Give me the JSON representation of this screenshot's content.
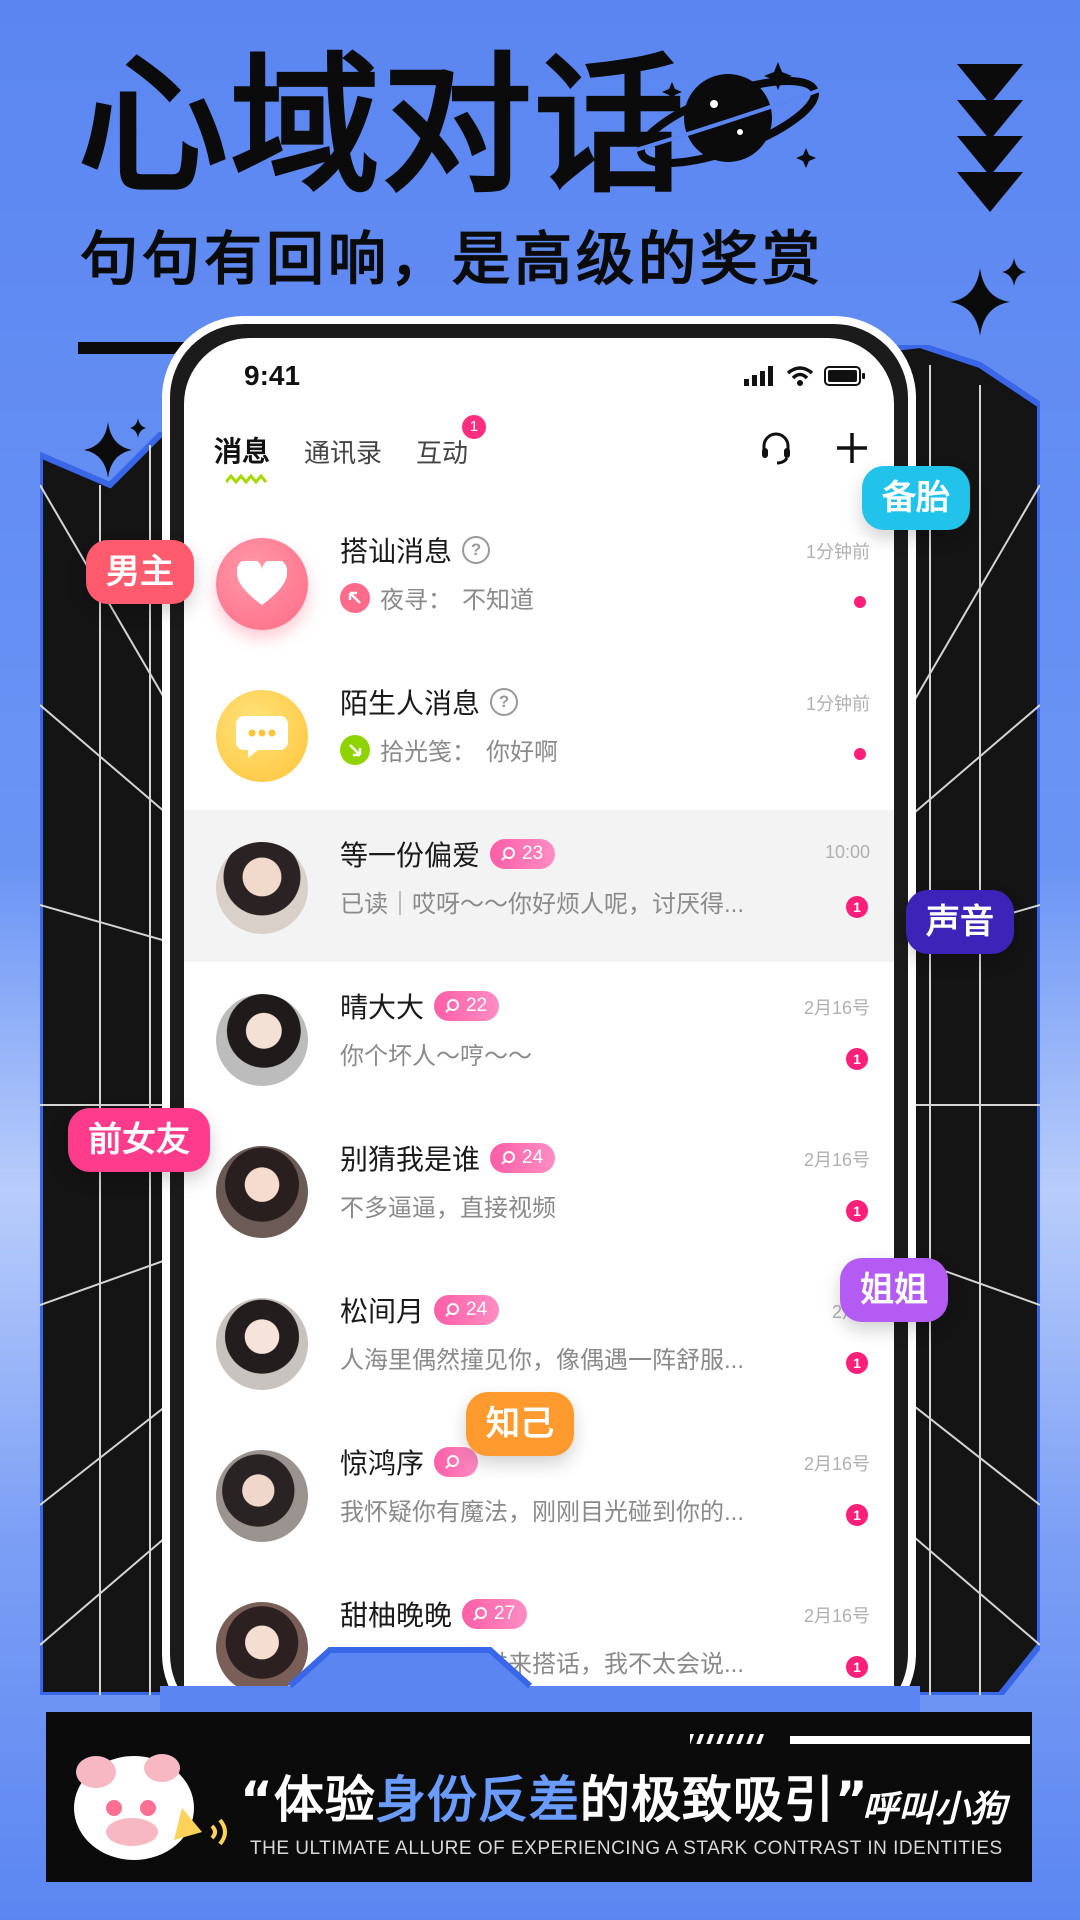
{
  "header": {
    "title": "心域对话",
    "subtitle": "句句有回响，是高级的奖赏"
  },
  "status_bar": {
    "time": "9:41"
  },
  "tabs": [
    {
      "label": "消息",
      "active": true
    },
    {
      "label": "通讯录",
      "active": false
    },
    {
      "label": "互动",
      "active": false,
      "badge": "1"
    }
  ],
  "top_icons": [
    "headset-icon",
    "plus-icon"
  ],
  "conversations": [
    {
      "name": "搭讪消息",
      "help": "?",
      "preview_from": "夜寻：",
      "preview": "不知道",
      "time": "1分钟前",
      "kind": "system",
      "unread_dot": true
    },
    {
      "name": "陌生人消息",
      "help": "?",
      "preview_from": "拾光笺：",
      "preview": "你好啊",
      "time": "1分钟前",
      "kind": "system",
      "unread_dot": true
    },
    {
      "name": "等一份偏爱",
      "level": "23",
      "preview": "已读｜哎呀～～你好烦人呢，讨厌得...",
      "time": "10:00",
      "unread": "1"
    },
    {
      "name": "晴大大",
      "level": "22",
      "preview": "你个坏人～哼～～",
      "time": "2月16号",
      "unread": "1"
    },
    {
      "name": "别猜我是谁",
      "level": "24",
      "preview": "不多逼逼，直接视频",
      "time": "2月16号",
      "unread": "1"
    },
    {
      "name": "松间月",
      "level": "24",
      "preview": "人海里偶然撞见你，像偶遇一阵舒服...",
      "time": "2月1",
      "unread": "1"
    },
    {
      "name": "惊鸿序",
      "level": "",
      "preview": "我怀疑你有魔法，刚刚目光碰到你的...",
      "time": "2月16号",
      "unread": "1"
    },
    {
      "name": "甜柚晚晚",
      "level": "27",
      "preview": "犹豫了好久才过来搭话，我不太会说...",
      "time": "2月16号",
      "unread": "1"
    }
  ],
  "tags": {
    "nanzhu": "男主",
    "beitai": "备胎",
    "shengyin": "声音",
    "qiannvyou": "前女友",
    "jiejie": "姐姐",
    "zhiji": "知己"
  },
  "banner": {
    "quote_open": "“体验",
    "quote_highlight": "身份反差",
    "quote_close": "的极致吸引”",
    "english": "THE ULTIMATE ALLURE OF EXPERIENCING A STARK CONTRAST IN IDENTITIES",
    "brand": "呼叫小狗"
  },
  "colors": {
    "background": "#5b86f1",
    "accent_pink": "#ff1f7a",
    "level_pill": "#ff6fb0",
    "highlight_text": "#6a9cff"
  }
}
